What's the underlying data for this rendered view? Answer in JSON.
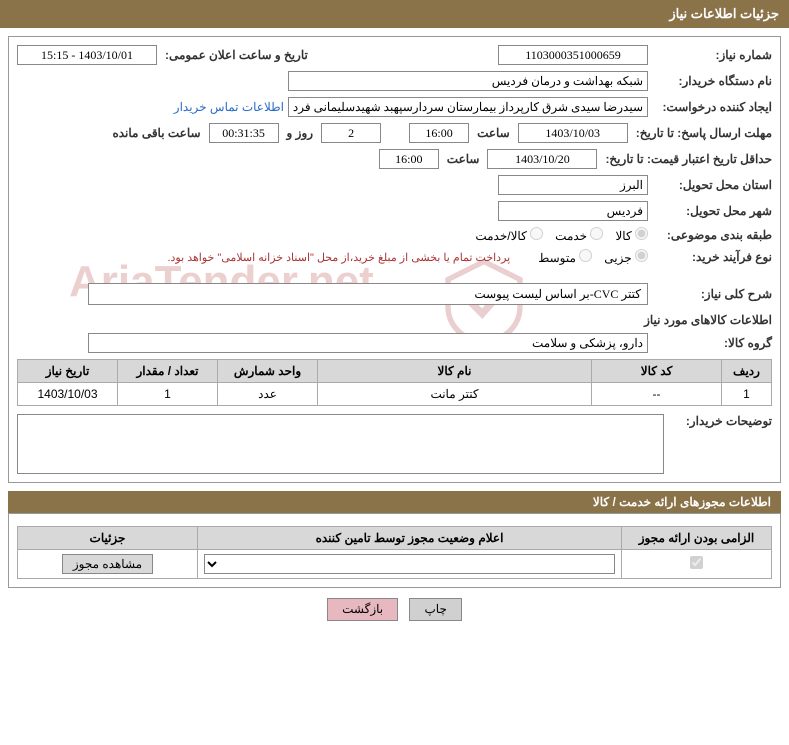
{
  "header": {
    "title": "جزئیات اطلاعات نیاز"
  },
  "form": {
    "need_no_label": "شماره نیاز:",
    "need_no": "1103000351000659",
    "announce_label": "تاریخ و ساعت اعلان عمومی:",
    "announce": "1403/10/01 - 15:15",
    "buyer_org_label": "نام دستگاه خریدار:",
    "buyer_org": "شبکه بهداشت و درمان فردیس",
    "requester_label": "ایجاد کننده درخواست:",
    "requester": "سیدرضا سیدی شرق کارپرداز بیمارستان سردارسپهبد شهیدسلیمانی فردیس ن",
    "contact_link": "اطلاعات تماس خریدار",
    "deadline_label": "مهلت ارسال پاسخ: تا تاریخ:",
    "deadline_date": "1403/10/03",
    "time_label": "ساعت",
    "deadline_time": "16:00",
    "days": "2",
    "days_and": "روز و",
    "remaining_time": "00:31:35",
    "remaining_label": "ساعت باقی مانده",
    "validity_label": "حداقل تاریخ اعتبار قیمت: تا تاریخ:",
    "validity_date": "1403/10/20",
    "validity_time": "16:00",
    "province_label": "استان محل تحویل:",
    "province": "البرز",
    "city_label": "شهر محل تحویل:",
    "city": "فردیس",
    "category_label": "طبقه بندی موضوعی:",
    "cat_goods": "کالا",
    "cat_service": "خدمت",
    "cat_both": "کالا/خدمت",
    "purchase_type_label": "نوع فرآیند خرید:",
    "pt_partial": "جزیی",
    "pt_medium": "متوسط",
    "purchase_note": "پرداخت تمام یا بخشی از مبلغ خرید،از محل \"اسناد خزانه اسلامی\" خواهد بود.",
    "desc_label": "شرح کلی نیاز:",
    "desc_value": "کتتر CVC-بر اساس لیست پیوست"
  },
  "goods_section": {
    "title": "اطلاعات کالاهای مورد نیاز",
    "group_label": "گروه کالا:",
    "group": "دارو، پزشکی و سلامت"
  },
  "goods_table": {
    "headers": {
      "row": "ردیف",
      "code": "کد کالا",
      "name": "نام کالا",
      "unit": "واحد شمارش",
      "qty": "تعداد / مقدار",
      "date": "تاریخ نیاز"
    },
    "rows": [
      {
        "row": "1",
        "code": "--",
        "name": "کتتر مانت",
        "unit": "عدد",
        "qty": "1",
        "date": "1403/10/03"
      }
    ]
  },
  "buyer_notes": {
    "label": "توضیحات خریدار:"
  },
  "permits": {
    "header": "اطلاعات مجوزهای ارائه خدمت / کالا",
    "table_headers": {
      "mandatory": "الزامی بودن ارائه مجوز",
      "status": "اعلام وضعیت مجوز توسط تامین کننده",
      "details": "جزئیات"
    },
    "view_btn": "مشاهده مجوز"
  },
  "buttons": {
    "print": "چاپ",
    "back": "بازگشت"
  },
  "watermark": "AriaTender.net"
}
